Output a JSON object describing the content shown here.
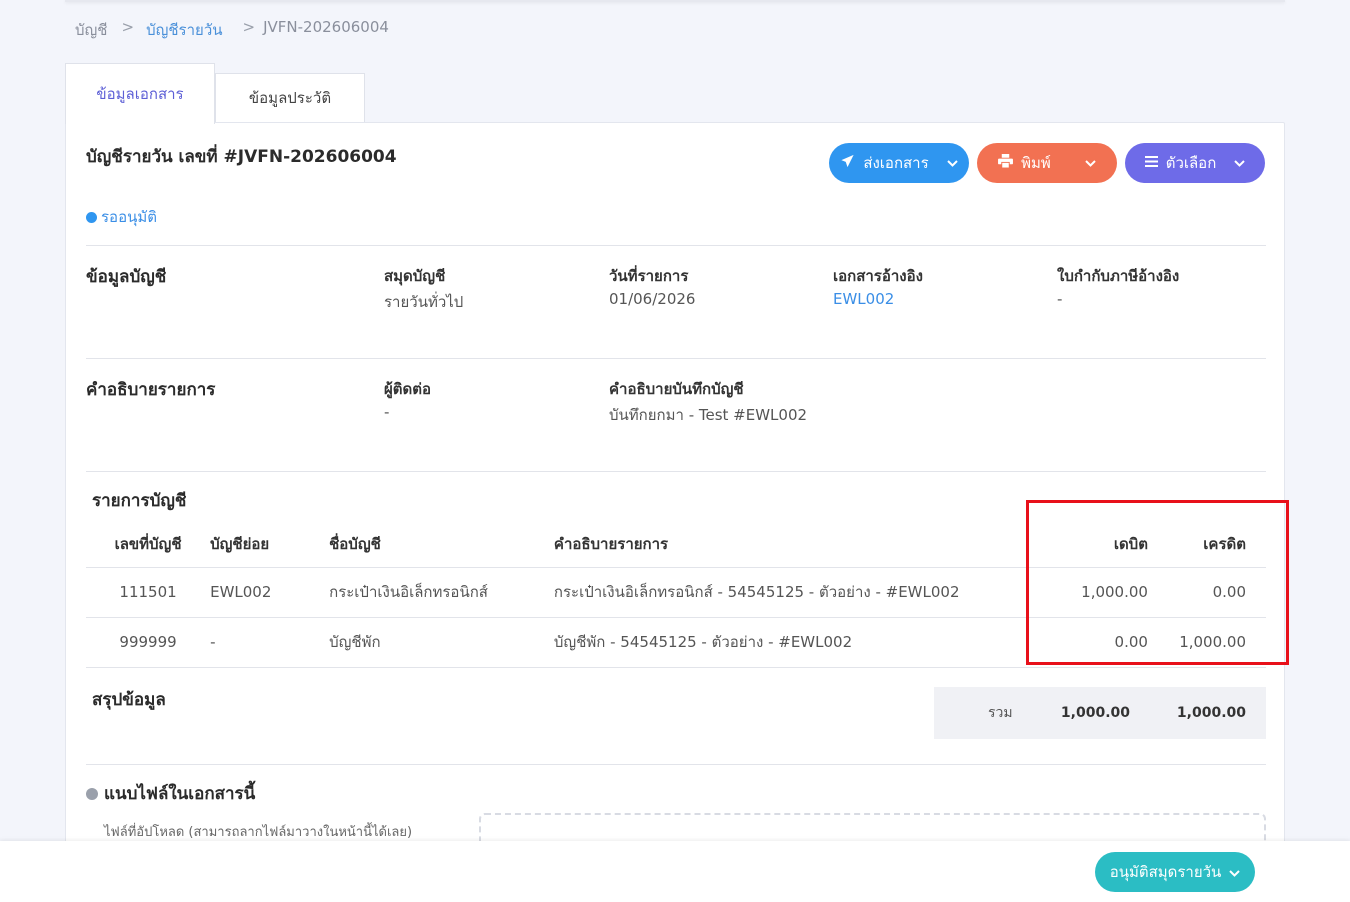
{
  "breadcrumb": {
    "root": "บัญชี",
    "sep": ">",
    "parent": "บัญชีรายวัน",
    "current": "JVFN-202606004"
  },
  "tabs": [
    {
      "label": "ข้อมูลเอกสาร",
      "active": true
    },
    {
      "label": "ข้อมูลประวัติ",
      "active": false
    }
  ],
  "header": {
    "title": "บัญชีรายวัน เลขที่ #JVFN-202606004",
    "status": "รออนุมัติ"
  },
  "actions": {
    "send_label": "ส่งเอกสาร",
    "print_label": "พิมพ์",
    "options_label": "ตัวเลือก",
    "send_icon": "paper-plane-icon",
    "print_icon": "printer-icon",
    "options_icon": "menu-icon",
    "colors": {
      "send": "#2f96f0",
      "print": "#f27152",
      "options": "#6e6be8"
    }
  },
  "account_info": {
    "section_title": "ข้อมูลบัญชี",
    "journal_book_label": "สมุดบัญชี",
    "journal_book_value": "รายวันทั่วไป",
    "date_label": "วันที่รายการ",
    "date_value": "01/06/2026",
    "ref_doc_label": "เอกสารอ้างอิง",
    "ref_doc_value": "EWL002",
    "tax_invoice_label": "ใบกำกับภาษีอ้างอิง",
    "tax_invoice_value": "-"
  },
  "description": {
    "section_title": "คำอธิบายรายการ",
    "contact_label": "ผู้ติดต่อ",
    "contact_value": "-",
    "memo_label": "คำอธิบายบันทึกบัญชี",
    "memo_value": "บันทึกยกมา - Test #EWL002"
  },
  "entries": {
    "section_title": "รายการบัญชี",
    "columns": [
      "เลขที่บัญชี",
      "บัญชีย่อย",
      "ชื่อบัญชี",
      "คำอธิบายรายการ",
      "เดบิต",
      "เครดิต"
    ],
    "rows": [
      {
        "account_no": "111501",
        "sub_account": "EWL002",
        "account_name": "กระเป๋าเงินอิเล็กทรอนิกส์",
        "description": "กระเป๋าเงินอิเล็กทรอนิกส์ - 54545125 - ตัวอย่าง - #EWL002",
        "debit": "1,000.00",
        "credit": "0.00"
      },
      {
        "account_no": "999999",
        "sub_account": "-",
        "account_name": "บัญชีพัก",
        "description": "บัญชีพัก - 54545125 - ตัวอย่าง - #EWL002",
        "debit": "0.00",
        "credit": "1,000.00"
      }
    ]
  },
  "summary": {
    "section_title": "สรุปข้อมูล",
    "total_label": "รวม",
    "total_debit": "1,000.00",
    "total_credit": "1,000.00"
  },
  "attachments": {
    "section_title": "แนบไฟล์ในเอกสารนี้",
    "note": "ไฟล์ที่อัปโหลด (สามารถลากไฟล์มาวางในหน้านี้ได้เลย)"
  },
  "footer": {
    "approve_label": "อนุมัติสมุดรายวัน",
    "approve_color": "#2bbdc4"
  }
}
